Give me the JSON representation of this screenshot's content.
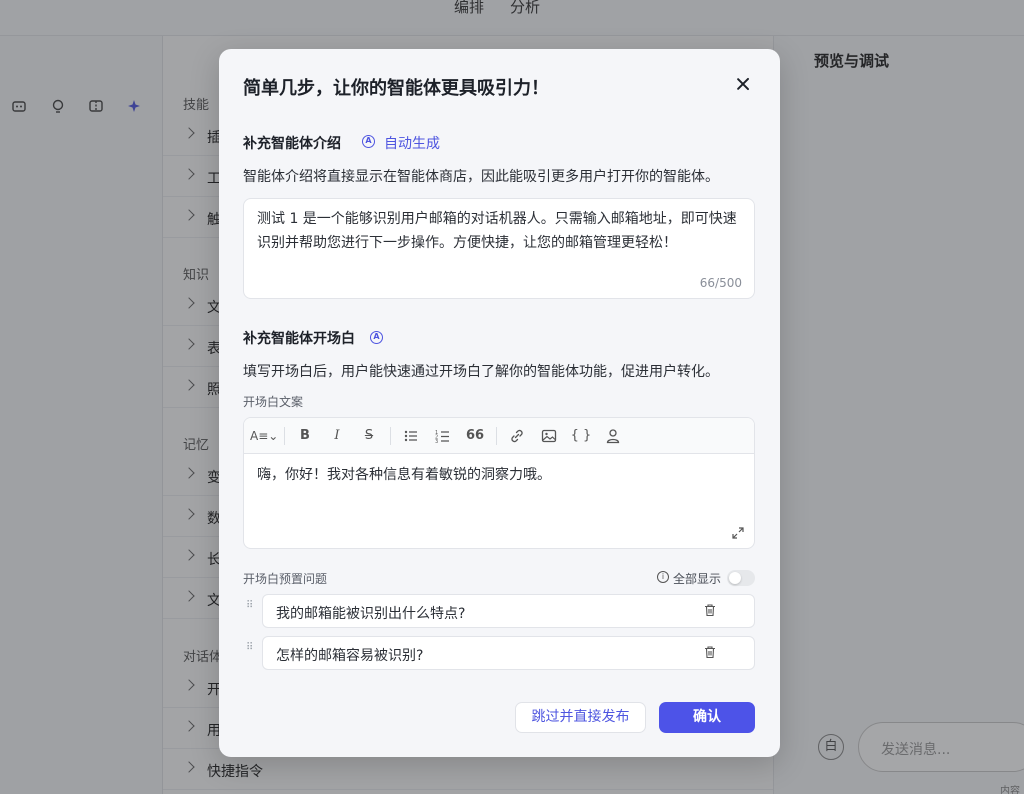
{
  "topbar": {
    "tabs": [
      "编排",
      "分析"
    ]
  },
  "skills_panel": {
    "sections": [
      {
        "label": "技能",
        "items": [
          "插",
          "工",
          "触"
        ]
      },
      {
        "label": "知识",
        "items": [
          "文",
          "表",
          "照"
        ]
      },
      {
        "label": "记忆",
        "items": [
          "变",
          "数",
          "长",
          "文"
        ]
      },
      {
        "label": "对话体",
        "items": [
          "开",
          "用",
          "快捷指令"
        ]
      }
    ]
  },
  "preview_panel": {
    "title": "预览与调试",
    "clear_icon_text": "白",
    "message_placeholder": "发送消息...",
    "footer_text": "内容"
  },
  "modal": {
    "title": "简单几步，让你的智能体更具吸引力！",
    "intro": {
      "section_title": "补充智能体介绍",
      "auto_generate": "自动生成",
      "description": "智能体介绍将直接显示在智能体商店，因此能吸引更多用户打开你的智能体。",
      "text": "测试 1 是一个能够识别用户邮箱的对话机器人。只需输入邮箱地址，即可快速识别并帮助您进行下一步操作。方便快捷，让您的邮箱管理更轻松！",
      "count": "66/500"
    },
    "opening": {
      "section_title": "补充智能体开场白",
      "description": "填写开场白后，用户能快速通过开场白了解你的智能体功能，促进用户转化。",
      "copy_label": "开场白文案",
      "copy_text": "嗨，你好！我对各种信息有着敏锐的洞察力哦。",
      "preset_label": "开场白预置问题",
      "show_all_label": "全部显示",
      "show_all_enabled": false,
      "questions": [
        "我的邮箱能被识别出什么特点?",
        "怎样的邮箱容易被识别?"
      ]
    },
    "buttons": {
      "skip": "跳过并直接发布",
      "confirm": "确认"
    }
  },
  "colors": {
    "accent": "#4d53e8",
    "link": "#4e55e0"
  }
}
